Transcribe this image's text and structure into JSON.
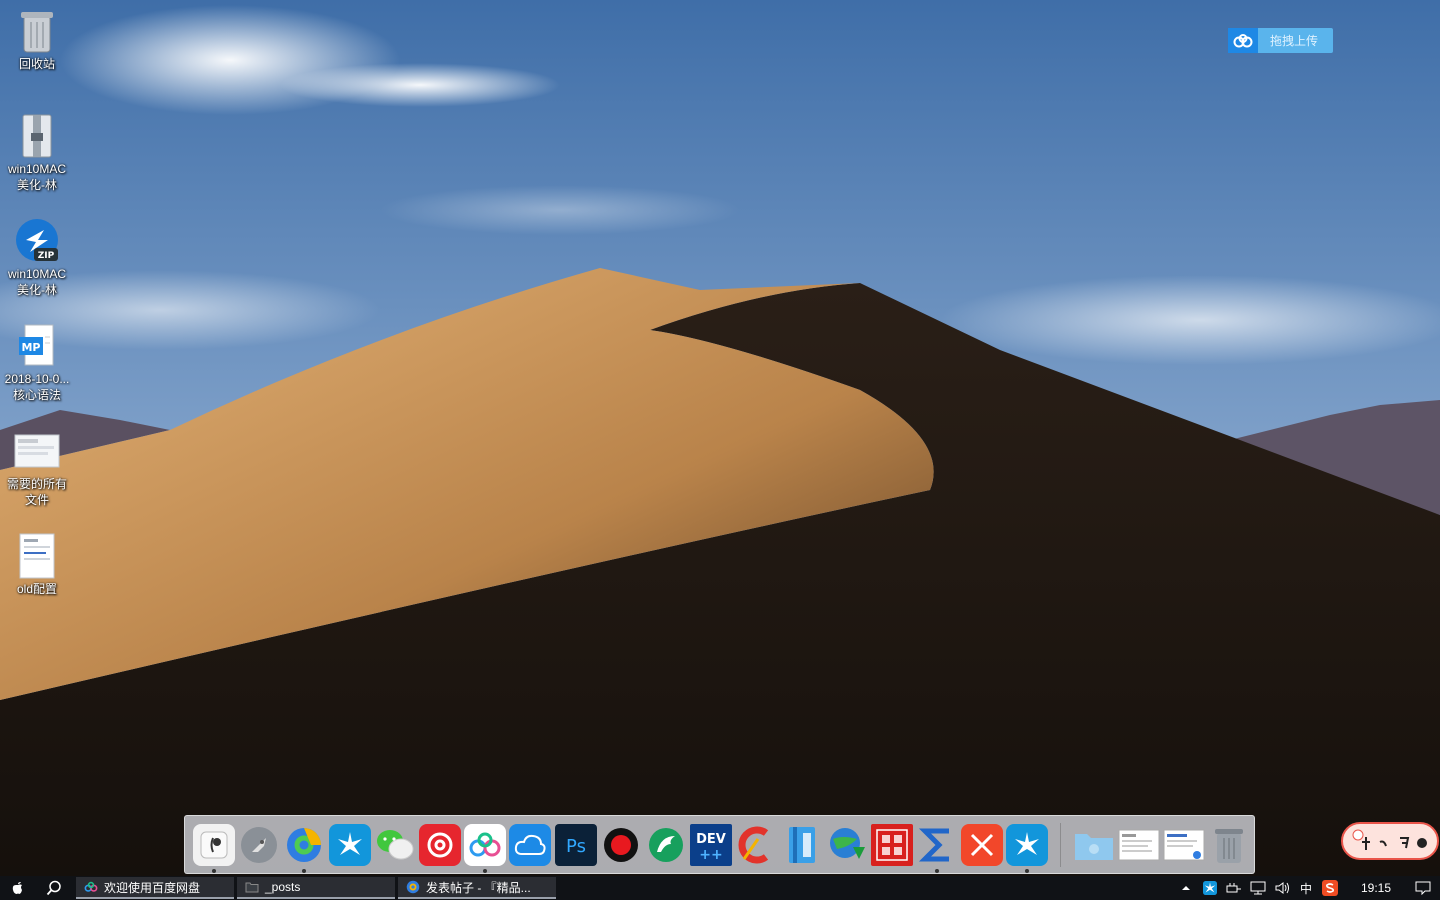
{
  "desktop": {
    "icons": [
      {
        "label": "回收站",
        "icon": "recycle-bin-icon"
      },
      {
        "label": "win10MAC美化-林",
        "icon": "folder-zip-icon"
      },
      {
        "label": "win10MAC美化-林",
        "icon": "zip-archive-icon"
      },
      {
        "label": "2018-10-0...核心语法",
        "icon": "mp-document-icon"
      },
      {
        "label": "需要的所有文件",
        "icon": "screenshot-thumbnail-icon"
      },
      {
        "label": "old配置",
        "icon": "document-thumbnail-icon"
      }
    ]
  },
  "upload_widget": {
    "label": "拖拽上传",
    "icon": "baidu-netdisk-icon"
  },
  "dock": {
    "apps": [
      {
        "name": "finder",
        "icon": "finder-icon",
        "running": true
      },
      {
        "name": "launchpad",
        "icon": "launchpad-rocket-icon",
        "running": false
      },
      {
        "name": "browser",
        "icon": "browser-icon",
        "running": true
      },
      {
        "name": "im-app",
        "icon": "star-app-icon",
        "running": false
      },
      {
        "name": "wechat",
        "icon": "wechat-icon",
        "running": false
      },
      {
        "name": "netease-music",
        "icon": "netease-music-icon",
        "running": false
      },
      {
        "name": "baidu-netdisk",
        "icon": "baidu-netdisk-icon",
        "running": true
      },
      {
        "name": "cloud-sync",
        "icon": "cloud-sync-icon",
        "running": false
      },
      {
        "name": "photoshop",
        "icon": "photoshop-icon",
        "running": false
      },
      {
        "name": "recorder",
        "icon": "record-icon",
        "running": false
      },
      {
        "name": "bird-app",
        "icon": "bird-icon",
        "running": false
      },
      {
        "name": "dev-cpp",
        "icon": "dev-cpp-icon",
        "running": false
      },
      {
        "name": "ccleaner",
        "icon": "ccleaner-icon",
        "running": false
      },
      {
        "name": "notebook",
        "icon": "notebook-icon",
        "running": false
      },
      {
        "name": "download-manager",
        "icon": "globe-download-icon",
        "running": false
      },
      {
        "name": "crack-app",
        "icon": "red-seal-icon",
        "running": false
      },
      {
        "name": "sigma-app",
        "icon": "sigma-icon",
        "running": true
      },
      {
        "name": "xmind",
        "icon": "xmind-icon",
        "running": false
      },
      {
        "name": "im-app-2",
        "icon": "star-app-icon",
        "running": true
      }
    ],
    "docs": [
      {
        "name": "folder",
        "icon": "folder-icon"
      },
      {
        "name": "doc-1",
        "icon": "document-preview-icon"
      },
      {
        "name": "doc-2",
        "icon": "document-preview-icon"
      },
      {
        "name": "trash",
        "icon": "trash-icon"
      }
    ],
    "separator_label": ""
  },
  "float_badge": {
    "label": "",
    "icon": "ime-badge-icon"
  },
  "taskbar": {
    "start_icon": "apple-icon",
    "search_icon": "search-icon",
    "windows": [
      {
        "title": "欢迎使用百度网盘",
        "icon": "baidu-netdisk-icon"
      },
      {
        "title": "_posts",
        "icon": "folder-icon"
      },
      {
        "title": "发表帖子 - 『精品...",
        "icon": "browser-icon"
      }
    ],
    "tray": {
      "ime": "中",
      "clock": "19:15"
    }
  },
  "colors": {
    "taskbar_bg": "#101216",
    "accent_blue": "#1e88e5",
    "netease_red": "#e6262e"
  }
}
